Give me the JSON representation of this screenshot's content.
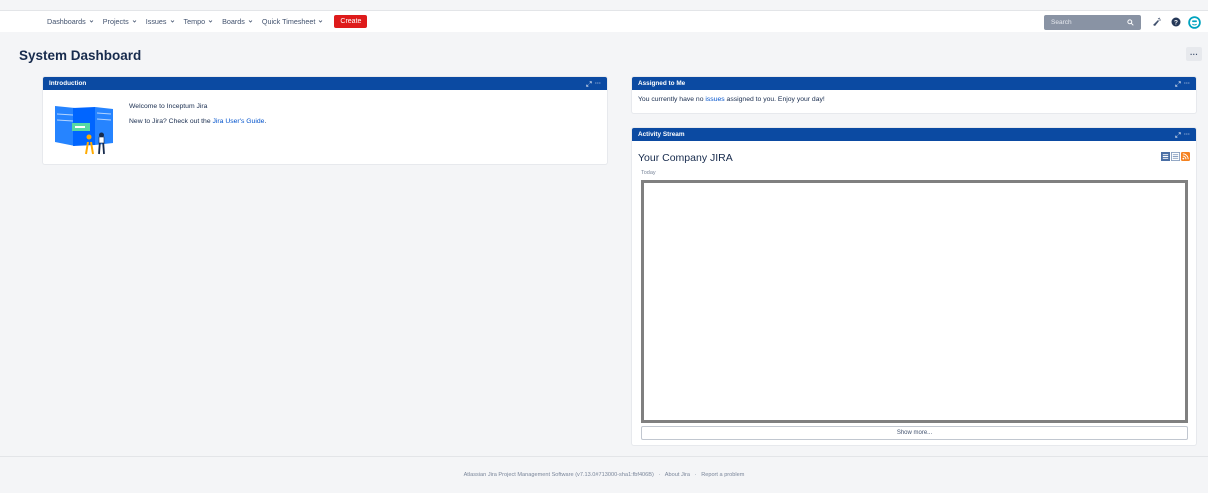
{
  "nav": {
    "items": [
      {
        "label": "Dashboards"
      },
      {
        "label": "Projects"
      },
      {
        "label": "Issues"
      },
      {
        "label": "Tempo"
      },
      {
        "label": "Boards"
      },
      {
        "label": "Quick Timesheet"
      }
    ],
    "create_label": "Create"
  },
  "topbar": {
    "search_placeholder": "Search",
    "icons": [
      "search-icon",
      "notifications-icon",
      "help-icon",
      "user-avatar-icon"
    ]
  },
  "page": {
    "title": "System Dashboard",
    "more_label": "···"
  },
  "intro": {
    "title": "Introduction",
    "welcome": "Welcome to Inceptum Jira",
    "newto_prefix": "New to Jira? Check out the ",
    "guide_link": "Jira User's Guide",
    "newto_suffix": "."
  },
  "assigned": {
    "title": "Assigned to Me",
    "text_prefix": "You currently have no ",
    "issues_link": "issues",
    "text_suffix": " assigned to you. Enjoy your day!"
  },
  "activity": {
    "title": "Activity Stream",
    "stream_title": "Your Company JIRA",
    "today": "Today",
    "show_more": "Show more..."
  },
  "footer": {
    "software": "Atlassian Jira Project Management Software (v7.13.0#713000-sha1:fbf406B)",
    "sep": "·",
    "about": "About Jira",
    "report": "Report a problem"
  },
  "colors": {
    "gadget_header": "#0b4aa2",
    "create": "#de1b1b",
    "link": "#0052cc"
  }
}
